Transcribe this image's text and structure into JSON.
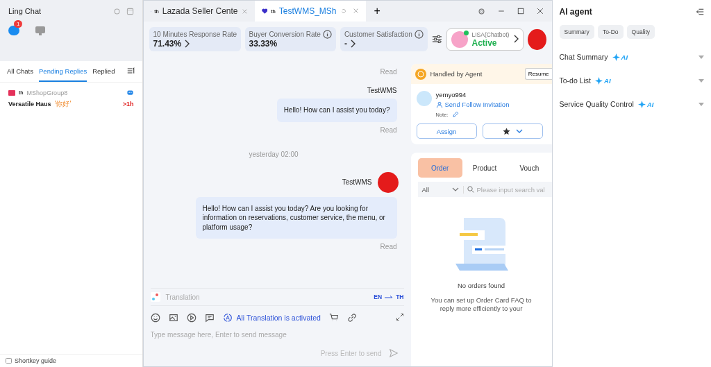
{
  "left_panel": {
    "title": "Ling Chat",
    "badge": "1",
    "tabs": [
      {
        "label": "All Chats",
        "selected": false
      },
      {
        "label": "Pending Replies",
        "selected": true
      },
      {
        "label": "Replied",
        "selected": false
      }
    ],
    "conversations": [
      {
        "flag": "th",
        "group": "MShopGroup8",
        "name": "Versatile Haus",
        "preview": "'你好'",
        "time": ">1h"
      }
    ],
    "footer": "Shortkey guide"
  },
  "window": {
    "tabs": [
      {
        "flag": "th",
        "title": "Lazada Seller Cente",
        "selected": false
      },
      {
        "flag": "th",
        "title": "TestWMS_MSh",
        "selected": true
      }
    ],
    "new_tab": "+"
  },
  "metrics": [
    {
      "label": "10 Minutes Response Rate",
      "value": "71.43%",
      "has_details": true
    },
    {
      "label": "Buyer Conversion Rate",
      "value": "33.33%",
      "has_details": false
    },
    {
      "label": "Customer Satisfaction",
      "value": "-",
      "has_details": true
    }
  ],
  "chatbot": {
    "name": "LISA(Chatbot)",
    "status": "Active"
  },
  "messages": [
    {
      "kind": "receipt",
      "text": "Read"
    },
    {
      "kind": "sender",
      "text": "TestWMS",
      "avatar": false
    },
    {
      "kind": "bubble",
      "text": "Hello! How can I assist you today?"
    },
    {
      "kind": "receipt",
      "text": "Read"
    },
    {
      "kind": "time",
      "text": "yesterday 02:00"
    },
    {
      "kind": "sender",
      "text": "TestWMS",
      "avatar": true
    },
    {
      "kind": "bubble",
      "text": "Hello! How can I assist you today? Are you looking for information on reservations, customer service, the menu, or platform usage?"
    },
    {
      "kind": "receipt",
      "text": "Read"
    }
  ],
  "translation": {
    "placeholder": "Translation",
    "source": "EN",
    "target": "TH"
  },
  "toolbar": {
    "status": "Ali Translation is activated"
  },
  "composer": {
    "placeholder": "Type message here, Enter to send message",
    "hint": "Press Enter to send"
  },
  "agent_card": {
    "status": "Handled by Agent",
    "resume": "Resume",
    "username": "yemyo994",
    "follow": "Send Follow Invitation",
    "note": "Note:",
    "assign": "Assign"
  },
  "order_panel": {
    "tabs": [
      {
        "label": "Order",
        "selected": true
      },
      {
        "label": "Product",
        "selected": false
      },
      {
        "label": "Vouch",
        "selected": false
      }
    ],
    "filter": "All",
    "search_placeholder": "Please input search val",
    "empty_title": "No orders found",
    "empty_text": "You can set up Order Card FAQ to",
    "empty_text_cut": "reply more efficiently to your"
  },
  "ai_panel": {
    "title": "AI agent",
    "chips": [
      "Summary",
      "To-Do",
      "Quality"
    ],
    "sections": [
      {
        "title": "Chat Summary",
        "badge": "AI",
        "expanded": false
      },
      {
        "title": "To-do List",
        "badge": "AI",
        "expanded": false
      },
      {
        "title": "Service Quality Control",
        "badge": "AI",
        "expanded": false
      }
    ]
  }
}
